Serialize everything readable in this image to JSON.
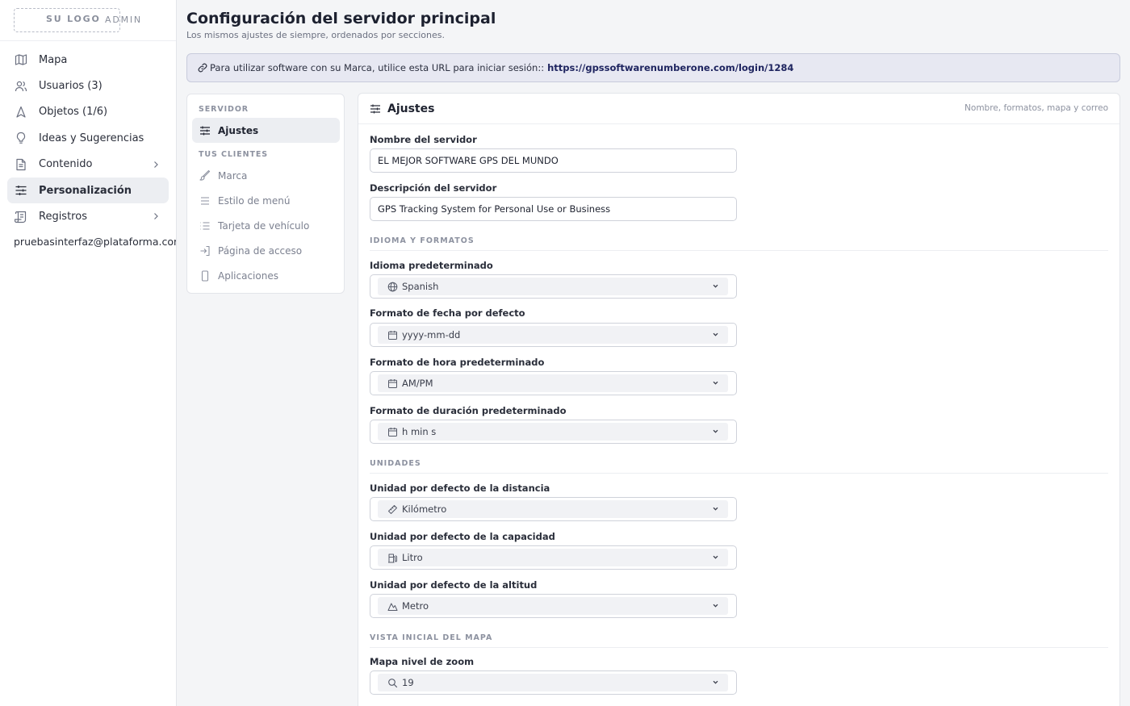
{
  "sidebar": {
    "logo_text": "SU LOGO",
    "admin_text": "ADMIN",
    "items": [
      {
        "label": "Mapa",
        "icon": "map-icon"
      },
      {
        "label": "Usuarios (3)",
        "icon": "users-icon"
      },
      {
        "label": "Objetos (1/6)",
        "icon": "navigation-icon"
      },
      {
        "label": "Ideas y Sugerencias",
        "icon": "lightbulb-icon"
      },
      {
        "label": "Contenido",
        "icon": "document-icon"
      },
      {
        "label": "Personalización",
        "icon": "sliders-icon"
      },
      {
        "label": "Registros",
        "icon": "scroll-icon"
      }
    ],
    "user_email": "pruebasinterfaz@plataforma.com (D"
  },
  "header": {
    "title": "Configuración del servidor principal",
    "subtitle": "Los mismos ajustes de siempre, ordenados por secciones."
  },
  "banner": {
    "text": "Para utilizar software con su Marca, utilice esta URL para iniciar sesión::",
    "url": "https://gpssoftwarenumberone.com/login/1284"
  },
  "subnav": {
    "server_section": "SERVIDOR",
    "server_items": [
      {
        "label": "Ajustes",
        "icon": "sliders-icon"
      }
    ],
    "clients_section": "TUS CLIENTES",
    "client_items": [
      {
        "label": "Marca",
        "icon": "brush-icon"
      },
      {
        "label": "Estilo de menú",
        "icon": "menu-icon"
      },
      {
        "label": "Tarjeta de vehículo",
        "icon": "list-icon"
      },
      {
        "label": "Página de acceso",
        "icon": "login-icon"
      },
      {
        "label": "Aplicaciones",
        "icon": "phone-icon"
      }
    ]
  },
  "card": {
    "title": "Ajustes",
    "hint": "Nombre, formatos, mapa y correo",
    "server_name_label": "Nombre del servidor",
    "server_name_value": "EL MEJOR SOFTWARE GPS DEL MUNDO",
    "server_desc_label": "Descripción del servidor",
    "server_desc_value": "GPS Tracking System for Personal Use or Business",
    "section_language": "IDIOMA Y FORMATOS",
    "language_label": "Idioma predeterminado",
    "language_value": "Spanish",
    "date_label": "Formato de fecha por defecto",
    "date_value": "yyyy-mm-dd",
    "time_label": "Formato de hora predeterminado",
    "time_value": "AM/PM",
    "duration_label": "Formato de duración predeterminado",
    "duration_value": "h min s",
    "section_units": "UNIDADES",
    "distance_label": "Unidad por defecto de la distancia",
    "distance_value": "Kilómetro",
    "capacity_label": "Unidad por defecto de la capacidad",
    "capacity_value": "Litro",
    "altitude_label": "Unidad por defecto de la altitud",
    "altitude_value": "Metro",
    "section_map": "VISTA INICIAL DEL MAPA",
    "zoom_label": "Mapa nivel de zoom",
    "zoom_value": "19"
  }
}
